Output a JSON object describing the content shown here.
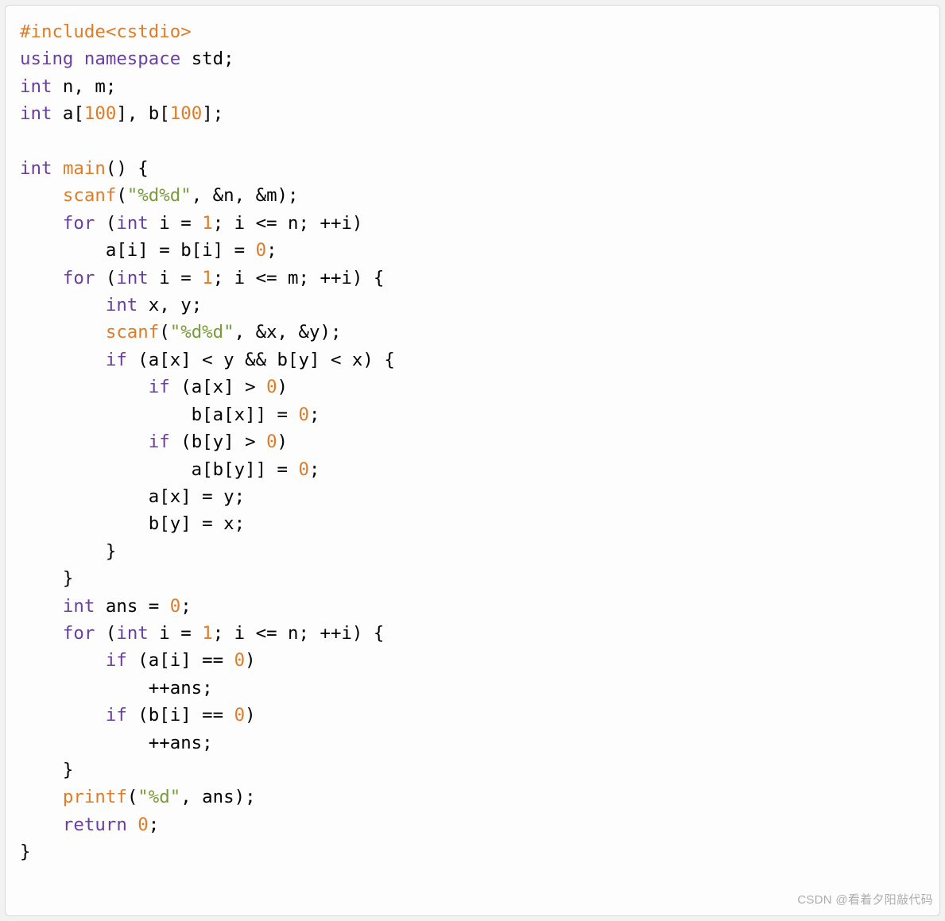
{
  "watermark": "CSDN @看着夕阳敲代码",
  "lines": [
    [
      {
        "cls": "tk-preproc",
        "t": "#include<cstdio>"
      }
    ],
    [
      {
        "cls": "tk-keyword",
        "t": "using"
      },
      {
        "cls": "tk-plain",
        "t": " "
      },
      {
        "cls": "tk-keyword",
        "t": "namespace"
      },
      {
        "cls": "tk-plain",
        "t": " std;"
      }
    ],
    [
      {
        "cls": "tk-type",
        "t": "int"
      },
      {
        "cls": "tk-plain",
        "t": " n, m;"
      }
    ],
    [
      {
        "cls": "tk-type",
        "t": "int"
      },
      {
        "cls": "tk-plain",
        "t": " a["
      },
      {
        "cls": "tk-number",
        "t": "100"
      },
      {
        "cls": "tk-plain",
        "t": "], b["
      },
      {
        "cls": "tk-number",
        "t": "100"
      },
      {
        "cls": "tk-plain",
        "t": "];"
      }
    ],
    [
      {
        "cls": "tk-plain",
        "t": ""
      }
    ],
    [
      {
        "cls": "tk-type",
        "t": "int"
      },
      {
        "cls": "tk-plain",
        "t": " "
      },
      {
        "cls": "tk-func",
        "t": "main"
      },
      {
        "cls": "tk-plain",
        "t": "() {"
      }
    ],
    [
      {
        "cls": "tk-plain",
        "t": "    "
      },
      {
        "cls": "tk-func",
        "t": "scanf"
      },
      {
        "cls": "tk-plain",
        "t": "("
      },
      {
        "cls": "tk-string",
        "t": "\"%d%d\""
      },
      {
        "cls": "tk-plain",
        "t": ", &n, &m);"
      }
    ],
    [
      {
        "cls": "tk-plain",
        "t": "    "
      },
      {
        "cls": "tk-keyword",
        "t": "for"
      },
      {
        "cls": "tk-plain",
        "t": " ("
      },
      {
        "cls": "tk-type",
        "t": "int"
      },
      {
        "cls": "tk-plain",
        "t": " i = "
      },
      {
        "cls": "tk-number",
        "t": "1"
      },
      {
        "cls": "tk-plain",
        "t": "; i <= n; ++i)"
      }
    ],
    [
      {
        "cls": "tk-plain",
        "t": "        a[i] = b[i] = "
      },
      {
        "cls": "tk-number",
        "t": "0"
      },
      {
        "cls": "tk-plain",
        "t": ";"
      }
    ],
    [
      {
        "cls": "tk-plain",
        "t": "    "
      },
      {
        "cls": "tk-keyword",
        "t": "for"
      },
      {
        "cls": "tk-plain",
        "t": " ("
      },
      {
        "cls": "tk-type",
        "t": "int"
      },
      {
        "cls": "tk-plain",
        "t": " i = "
      },
      {
        "cls": "tk-number",
        "t": "1"
      },
      {
        "cls": "tk-plain",
        "t": "; i <= m; ++i) {"
      }
    ],
    [
      {
        "cls": "tk-plain",
        "t": "        "
      },
      {
        "cls": "tk-type",
        "t": "int"
      },
      {
        "cls": "tk-plain",
        "t": " x, y;"
      }
    ],
    [
      {
        "cls": "tk-plain",
        "t": "        "
      },
      {
        "cls": "tk-func",
        "t": "scanf"
      },
      {
        "cls": "tk-plain",
        "t": "("
      },
      {
        "cls": "tk-string",
        "t": "\"%d%d\""
      },
      {
        "cls": "tk-plain",
        "t": ", &x, &y);"
      }
    ],
    [
      {
        "cls": "tk-plain",
        "t": "        "
      },
      {
        "cls": "tk-keyword",
        "t": "if"
      },
      {
        "cls": "tk-plain",
        "t": " (a[x] < y && b[y] < x) {"
      }
    ],
    [
      {
        "cls": "tk-plain",
        "t": "            "
      },
      {
        "cls": "tk-keyword",
        "t": "if"
      },
      {
        "cls": "tk-plain",
        "t": " (a[x] > "
      },
      {
        "cls": "tk-number",
        "t": "0"
      },
      {
        "cls": "tk-plain",
        "t": ")"
      }
    ],
    [
      {
        "cls": "tk-plain",
        "t": "                b[a[x]] = "
      },
      {
        "cls": "tk-number",
        "t": "0"
      },
      {
        "cls": "tk-plain",
        "t": ";"
      }
    ],
    [
      {
        "cls": "tk-plain",
        "t": "            "
      },
      {
        "cls": "tk-keyword",
        "t": "if"
      },
      {
        "cls": "tk-plain",
        "t": " (b[y] > "
      },
      {
        "cls": "tk-number",
        "t": "0"
      },
      {
        "cls": "tk-plain",
        "t": ")"
      }
    ],
    [
      {
        "cls": "tk-plain",
        "t": "                a[b[y]] = "
      },
      {
        "cls": "tk-number",
        "t": "0"
      },
      {
        "cls": "tk-plain",
        "t": ";"
      }
    ],
    [
      {
        "cls": "tk-plain",
        "t": "            a[x] = y;"
      }
    ],
    [
      {
        "cls": "tk-plain",
        "t": "            b[y] = x;"
      }
    ],
    [
      {
        "cls": "tk-plain",
        "t": "        }"
      }
    ],
    [
      {
        "cls": "tk-plain",
        "t": "    }"
      }
    ],
    [
      {
        "cls": "tk-plain",
        "t": "    "
      },
      {
        "cls": "tk-type",
        "t": "int"
      },
      {
        "cls": "tk-plain",
        "t": " ans = "
      },
      {
        "cls": "tk-number",
        "t": "0"
      },
      {
        "cls": "tk-plain",
        "t": ";"
      }
    ],
    [
      {
        "cls": "tk-plain",
        "t": "    "
      },
      {
        "cls": "tk-keyword",
        "t": "for"
      },
      {
        "cls": "tk-plain",
        "t": " ("
      },
      {
        "cls": "tk-type",
        "t": "int"
      },
      {
        "cls": "tk-plain",
        "t": " i = "
      },
      {
        "cls": "tk-number",
        "t": "1"
      },
      {
        "cls": "tk-plain",
        "t": "; i <= n; ++i) {"
      }
    ],
    [
      {
        "cls": "tk-plain",
        "t": "        "
      },
      {
        "cls": "tk-keyword",
        "t": "if"
      },
      {
        "cls": "tk-plain",
        "t": " (a[i] == "
      },
      {
        "cls": "tk-number",
        "t": "0"
      },
      {
        "cls": "tk-plain",
        "t": ")"
      }
    ],
    [
      {
        "cls": "tk-plain",
        "t": "            ++ans;"
      }
    ],
    [
      {
        "cls": "tk-plain",
        "t": "        "
      },
      {
        "cls": "tk-keyword",
        "t": "if"
      },
      {
        "cls": "tk-plain",
        "t": " (b[i] == "
      },
      {
        "cls": "tk-number",
        "t": "0"
      },
      {
        "cls": "tk-plain",
        "t": ")"
      }
    ],
    [
      {
        "cls": "tk-plain",
        "t": "            ++ans;"
      }
    ],
    [
      {
        "cls": "tk-plain",
        "t": "    }"
      }
    ],
    [
      {
        "cls": "tk-plain",
        "t": "    "
      },
      {
        "cls": "tk-func",
        "t": "printf"
      },
      {
        "cls": "tk-plain",
        "t": "("
      },
      {
        "cls": "tk-string",
        "t": "\"%d\""
      },
      {
        "cls": "tk-plain",
        "t": ", ans);"
      }
    ],
    [
      {
        "cls": "tk-plain",
        "t": "    "
      },
      {
        "cls": "tk-keyword",
        "t": "return"
      },
      {
        "cls": "tk-plain",
        "t": " "
      },
      {
        "cls": "tk-number",
        "t": "0"
      },
      {
        "cls": "tk-plain",
        "t": ";"
      }
    ],
    [
      {
        "cls": "tk-plain",
        "t": "}"
      }
    ]
  ]
}
